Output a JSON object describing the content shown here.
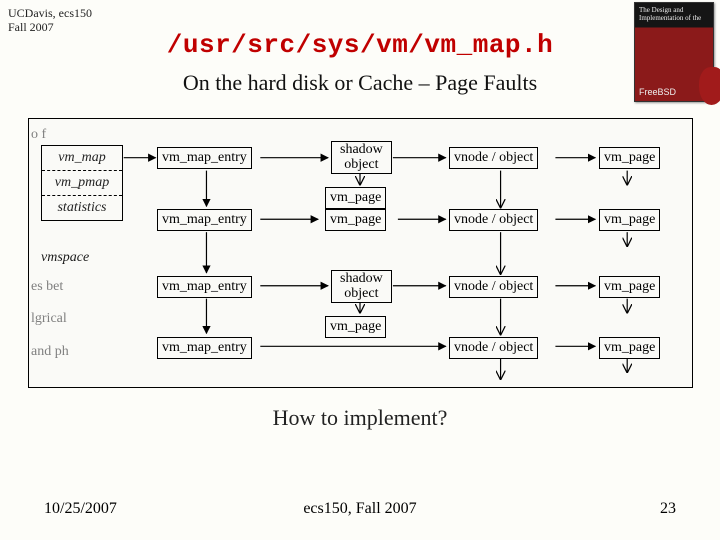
{
  "course": {
    "line1": "UCDavis, ecs150",
    "line2": "Fall 2007"
  },
  "title": "/usr/src/sys/vm/vm_map.h",
  "subtitle": "On the hard disk or Cache – Page Faults",
  "book": {
    "title": "The Design and Implementation of the",
    "product": "FreeBSD"
  },
  "caption": "How to implement?",
  "footer": {
    "date": "10/25/2007",
    "center": "ecs150, Fall 2007",
    "page": "23"
  },
  "side": {
    "vm_map": "vm_map",
    "vm_pmap": "vm_pmap",
    "statistics": "statistics",
    "vmspace": "vmspace"
  },
  "nodes": {
    "vme": "vm_map_entry",
    "shadow": "shadow\nobject",
    "vnode": "vnode / object",
    "vmpage": "vm_page"
  },
  "fragments": {
    "f1": "o f",
    "f2": "es bet",
    "f3": "lgrical",
    "f4": "and ph"
  }
}
